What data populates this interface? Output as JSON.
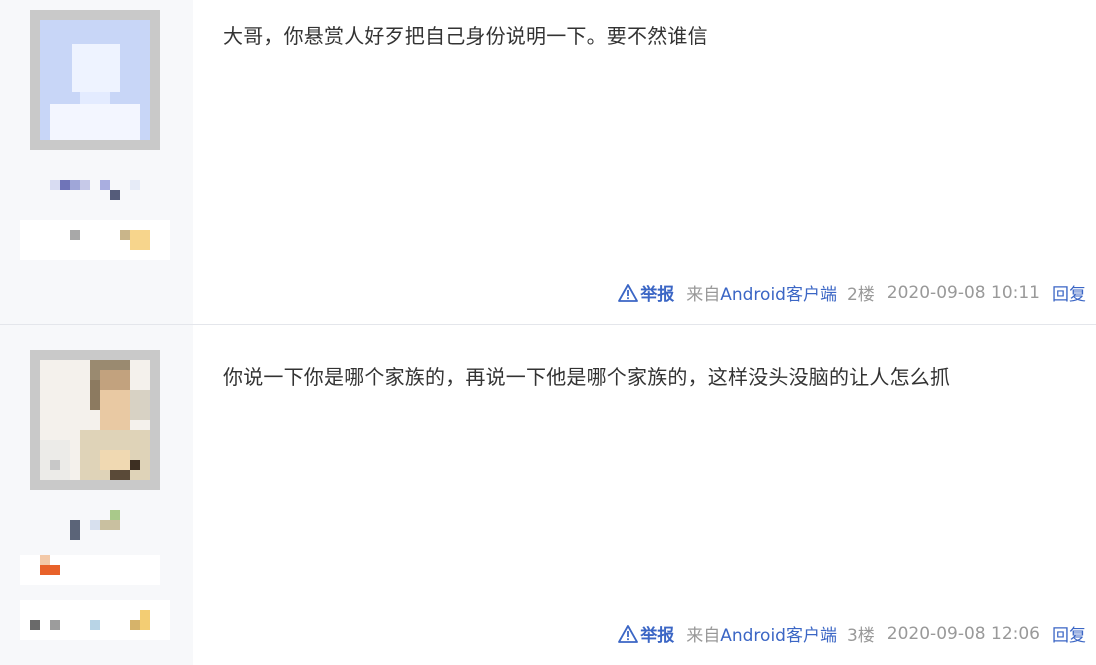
{
  "posts": [
    {
      "content": "大哥，你悬赏人好歹把自己身份说明一下。要不然谁信",
      "report_label": "举报",
      "source_prefix": "来自",
      "source_platform": "Android客户端",
      "floor": "2楼",
      "time": "2020-09-08 10:11",
      "reply_label": "回复"
    },
    {
      "content": "你说一下你是哪个家族的，再说一下他是哪个家族的，这样没头没脑的让人怎么抓",
      "report_label": "举报",
      "source_prefix": "来自",
      "source_platform": "Android客户端",
      "floor": "3楼",
      "time": "2020-09-08 12:06",
      "reply_label": "回复"
    }
  ],
  "icons": {
    "report": "warning-triangle-icon"
  },
  "colors": {
    "link": "#3b66c5",
    "meta": "#999999",
    "text": "#333333",
    "sidebar": "#f7f8fa"
  }
}
